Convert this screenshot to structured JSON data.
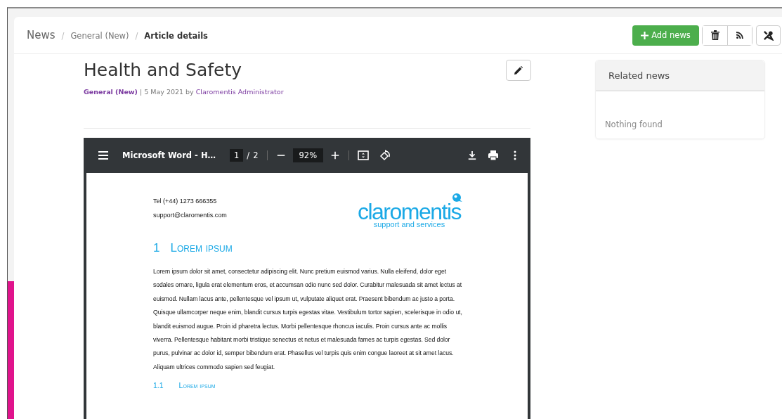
{
  "breadcrumb": [
    {
      "label": "News",
      "current": false
    },
    {
      "separator_before": "/",
      "label": "General (New)",
      "current": false
    },
    {
      "separator_before": "/",
      "label": "Article details",
      "current": true
    }
  ],
  "toolbar": {
    "add_button": "Add news"
  },
  "article": {
    "title": "Health and Safety",
    "category": "General (New)",
    "separator": "|",
    "date": "5 May 2021",
    "by": "by",
    "author": "Claromentis Administrator"
  },
  "pdf_viewer": {
    "file_name": "Microsoft Word - H…",
    "page": "1",
    "page_separator": "/",
    "page_count": "2",
    "zoom": "92%"
  },
  "document": {
    "phone": "Tel (+44) 1273 666355",
    "email": "support@claromentis.com",
    "logo_name": "claromentis",
    "logo_tagline": "support and services",
    "heading_number": "1",
    "heading": "Lorem ipsum",
    "paragraph": "Lorem ipsum dolor sit amet, consectetur adipiscing elit. Nunc pretium euismod varius. Nulla eleifend, dolor eget sodales ornare, ligula erat elementum eros, et accumsan odio nunc sed dolor. Curabitur malesuada sit amet lectus at euismod. Nullam lacus ante, pellentesque vel ipsum ut, vulputate aliquet erat. Praesent bibendum ac justo a porta. Quisque ullamcorper neque enim, blandit cursus turpis egestas vitae. Vestibulum tortor sapien, scelerisque in odio ut, blandit euismod augue. Proin id pharetra lectus. Morbi pellentesque rhoncus iaculis. Proin cursus ante ac mollis viverra. Pellentesque habitant morbi tristique senectus et netus et malesuada fames ac turpis egestas. Sed dolor purus, pulvinar ac dolor id, semper bibendum erat. Phasellus vel turpis quis enim congue laoreet at sit amet lacus. Aliquam ultrices commodo sapien sed feugiat.",
    "subheading_number": "1.1",
    "subheading": "Lorem ipsum"
  },
  "related": {
    "title": "Related news",
    "empty_text": "Nothing found"
  }
}
